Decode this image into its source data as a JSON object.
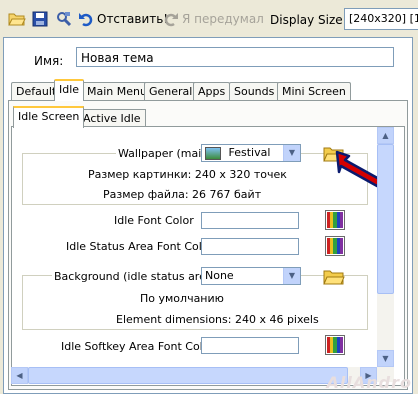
{
  "toolbar": {
    "undo_label": "Отставить!",
    "redo_label": "Я передумал",
    "display_size_label": "Display Size:",
    "display_size_value": "[240x320]  [12"
  },
  "theme": {
    "name_label": "Имя:",
    "name_value": "Новая тема"
  },
  "tabs": [
    "Default",
    "Idle",
    "Main Menu",
    "General",
    "Apps",
    "Sounds",
    "Mini Screen"
  ],
  "subtabs": [
    "Idle Screen",
    "Active Idle"
  ],
  "wallpaper": {
    "label": "Wallpaper (main)",
    "selected": "Festival",
    "size_text": "Размер картинки:  240 x 320 точек",
    "filesize_text": "Размер файла:  26 767 байт"
  },
  "colors": {
    "idle_font": "Idle Font Color",
    "idle_status": "Idle Status Area Font Color",
    "idle_softkey": "Idle Softkey Area Font Color"
  },
  "background": {
    "label": "Background (idle status area)",
    "selected": "None",
    "default_text": "По умолчанию",
    "dimensions_text": "Element dimensions:  240 x 46 pixels"
  },
  "watermark": "AllAndro"
}
